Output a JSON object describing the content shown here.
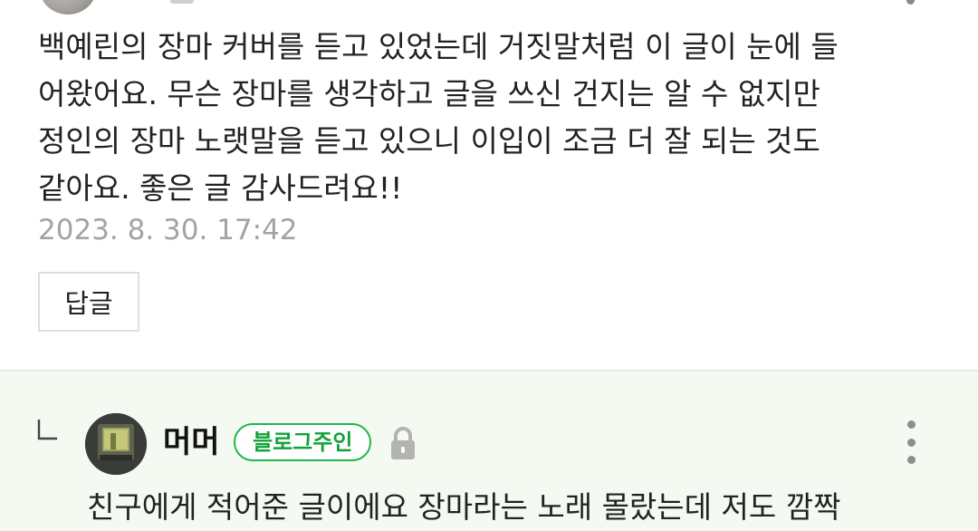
{
  "comment": {
    "body_lines": [
      "백예린의 장마 커버를 듣고 있었는데 거짓말처럼 이 글이 눈에 들",
      "어왔어요. 무슨 장마를 생각하고 글을 쓰신 건지는 알 수 없지만",
      "정인의 장마 노랫말을 듣고 있으니 이입이 조금 더 잘 되는 것도",
      "같아요. 좋은 글 감사드려요!!"
    ],
    "date": "2023. 8. 30. 17:42",
    "reply_label": "답글"
  },
  "reply": {
    "author": "머머",
    "badge": "블로그주인",
    "body": "친구에게 적어준 글이에요 장마라는 노래 몰랐는데 저도 깜짝"
  },
  "icons": {
    "reply_indent": "reply-indent-icon",
    "lock": "lock-icon",
    "more": "more-vertical-icon"
  },
  "colors": {
    "badge_green": "#1fb84a",
    "reply_background": "#f4f9f2",
    "date_gray": "#a3a3a3"
  }
}
